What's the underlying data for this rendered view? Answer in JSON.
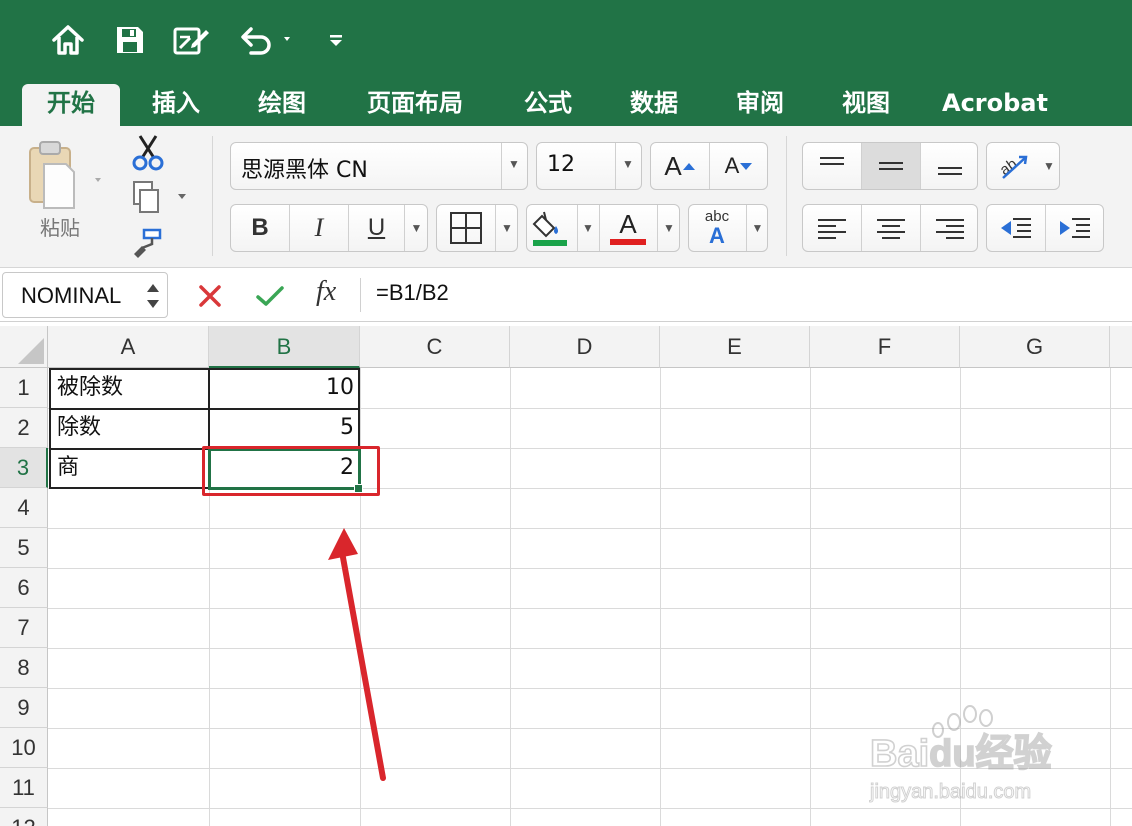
{
  "quick_access": {
    "icons": [
      "home-icon",
      "save-icon",
      "edit-document-icon",
      "undo-icon",
      "customize-toolbar-icon"
    ],
    "bar_color": "#217346"
  },
  "tabs": [
    {
      "label": "开始",
      "active": true
    },
    {
      "label": "插入"
    },
    {
      "label": "绘图"
    },
    {
      "label": "页面布局"
    },
    {
      "label": "公式"
    },
    {
      "label": "数据"
    },
    {
      "label": "审阅"
    },
    {
      "label": "视图"
    },
    {
      "label": "Acrobat"
    }
  ],
  "ribbon": {
    "paste_label": "粘贴",
    "font_name": "思源黑体 CN",
    "font_size": "12",
    "bold": "B",
    "italic": "I",
    "underline": "U",
    "grow_font": "A",
    "shrink_font": "A",
    "font_color_letter": "A",
    "phonetic_text": "abc",
    "phonetic_letter": "A",
    "fill_color": "#1aa34a",
    "font_color": "#e02020"
  },
  "formula_bar": {
    "name_box": "NOMINAL",
    "fx": "fx",
    "formula": "=B1/B2"
  },
  "sheet": {
    "columns": [
      "A",
      "B",
      "C",
      "D",
      "E",
      "F",
      "G"
    ],
    "rows": [
      "1",
      "2",
      "3",
      "4",
      "5",
      "6",
      "7",
      "8",
      "9",
      "10",
      "11",
      "12"
    ],
    "selected_cell": "B3",
    "cells": {
      "A1": "被除数",
      "B1": "10",
      "A2": "除数",
      "B2": "5",
      "A3": "商",
      "B3": "2"
    }
  },
  "annotation_color": "#d9262c",
  "watermark": {
    "logo_text": "Baidu经验",
    "url": "jingyan.baidu.com"
  }
}
